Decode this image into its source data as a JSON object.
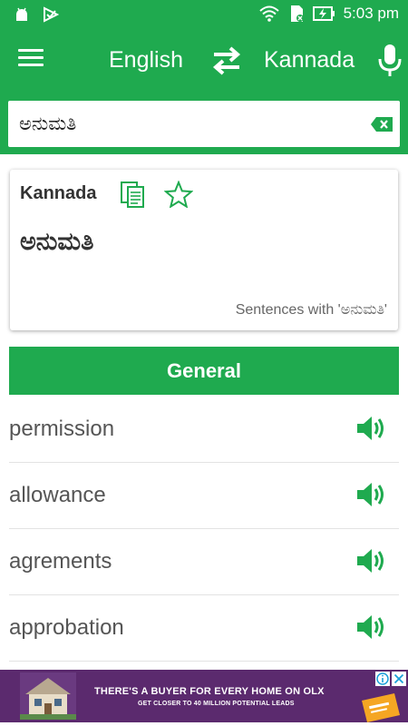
{
  "status_bar": {
    "time": "5:03 pm",
    "left_icons": [
      "android-icon",
      "check-notification-icon"
    ],
    "right_icons": [
      "wifi-icon",
      "sim-icon",
      "battery-charging-icon"
    ]
  },
  "app_bar": {
    "source_language": "English",
    "target_language": "Kannada",
    "icons": [
      "menu-icon",
      "swap-icon",
      "mic-icon"
    ]
  },
  "search": {
    "value": "ಅನುಮತಿ",
    "clear_icon": "backspace-clear-icon"
  },
  "result_card": {
    "language": "Kannada",
    "word": "ಅನುಮತಿ",
    "sentences_link": "Sentences with 'ಅನುಮತಿ'",
    "icons": [
      "copy-icon",
      "star-icon"
    ]
  },
  "section": {
    "title": "General"
  },
  "words": [
    {
      "text": "permission"
    },
    {
      "text": "allowance"
    },
    {
      "text": "agrements"
    },
    {
      "text": "approbation"
    }
  ],
  "ad": {
    "headline": "THERE'S A BUYER FOR EVERY HOME ON OLX",
    "subline": "GET CLOSER TO 40 MILLION POTENTIAL LEADS",
    "icons": [
      "ad-info-icon",
      "ad-close-icon"
    ]
  },
  "colors": {
    "primary_green": "#1faa4f",
    "ad_purple": "#5b2a6e",
    "text_dark": "#333333",
    "text_muted": "#666666"
  }
}
